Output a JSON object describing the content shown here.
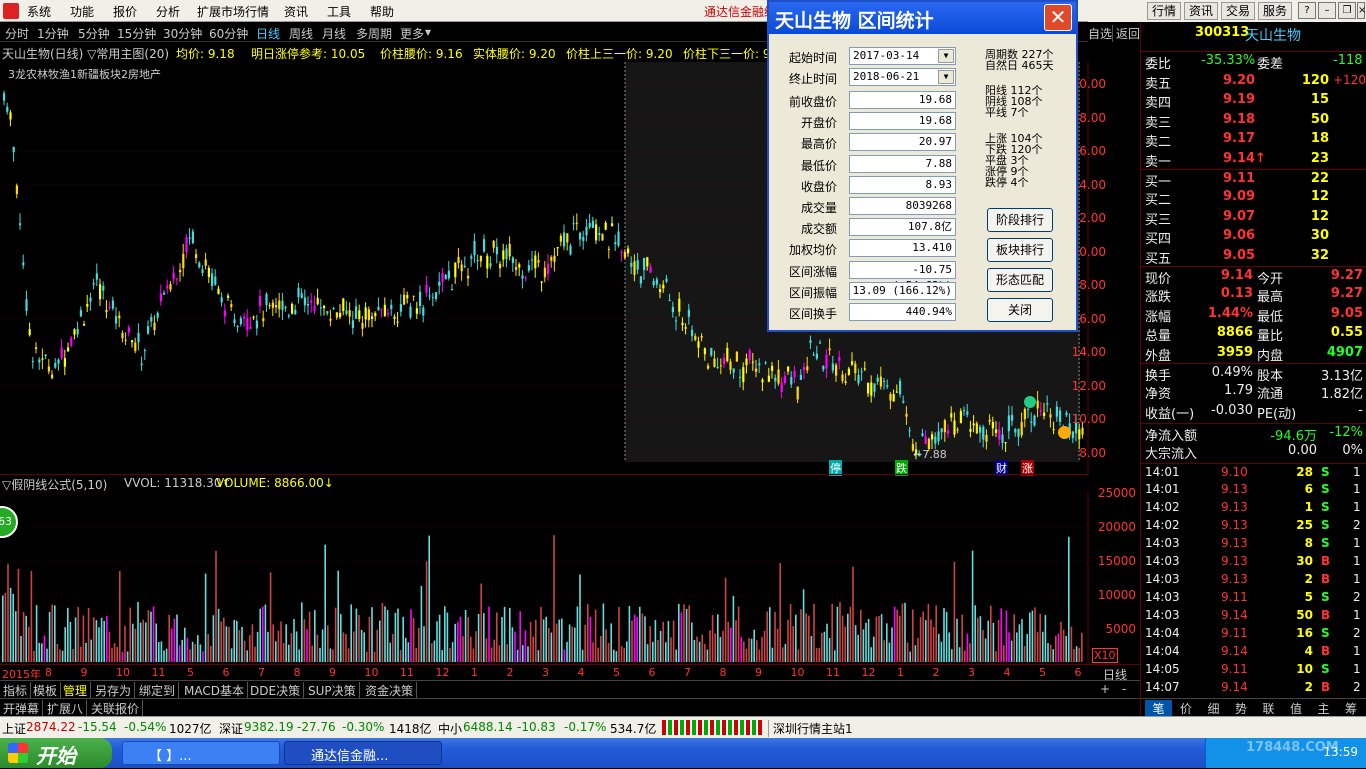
{
  "menu": {
    "items": [
      "系统",
      "功能",
      "报价",
      "分析",
      "扩展市场行情",
      "资讯",
      "工具",
      "帮助"
    ],
    "brand": "通达信金融终",
    "right_buttons": [
      "行情",
      "资讯",
      "交易",
      "服务"
    ]
  },
  "periods": {
    "items": [
      "分时",
      "1分钟",
      "5分钟",
      "15分钟",
      "30分钟",
      "60分钟",
      "日线",
      "周线",
      "月线",
      "多周期",
      "更多"
    ],
    "active": "日线",
    "nav_right": [
      "自选",
      "返回"
    ]
  },
  "info_line": {
    "title": "天山生物(日线) ▽常用主图(20)",
    "avg": "均价: 9.18",
    "limit_ref": "明日涨停参考: 10.05",
    "waist": "价柱腰价: 9.16",
    "body_waist": "实体腰价: 9.20",
    "upper1": "价柱上三一价: 9.20",
    "lower1": "价柱下三一价: 9"
  },
  "sector_line": "3龙农林牧渔1新疆板块2房地产",
  "price_axis": [
    "30.00",
    "28.00",
    "26.00",
    "24.00",
    "22.00",
    "20.00",
    "18.00",
    "16.00",
    "14.00",
    "12.00",
    "10.00",
    "8.00"
  ],
  "low_label": "7.88",
  "event_tags": [
    "停",
    "跌",
    "财",
    "涨"
  ],
  "sub_info": {
    "name": "▽假阴线公式(5,10)",
    "vvol": "VVOL: 11318.30↑",
    "volume": "VOLUME: 8866.00↓"
  },
  "vol_axis": [
    "25000",
    "20000",
    "15000",
    "10000",
    "5000"
  ],
  "vol_unit": "X10",
  "vol_badge": "63",
  "x_axis": {
    "labels": [
      "2015年",
      "8",
      "9",
      "10",
      "11",
      "5",
      "6",
      "7",
      "8",
      "9",
      "10",
      "11",
      "12",
      "1",
      "2",
      "3",
      "4",
      "5",
      "6",
      "7",
      "8",
      "9",
      "10",
      "11",
      "12",
      "1",
      "2",
      "3",
      "4",
      "5",
      "6"
    ],
    "right": "日线"
  },
  "tabs_row1": [
    "指标",
    "模板",
    "管理",
    "另存为",
    "绑定到",
    "MACD基本",
    "DDE决策",
    "SUP决策",
    "资金决策"
  ],
  "tabs_row1_selected": "管理",
  "tabs_row2": [
    "开弹幕",
    "扩展八",
    "关联报价"
  ],
  "dialog": {
    "title": "天山生物  区间统计",
    "start_label": "起始时间",
    "start": "2017-03-14",
    "end_label": "终止时间",
    "end": "2018-06-21",
    "fields": [
      {
        "label": "前收盘价",
        "value": "19.68"
      },
      {
        "label": "开盘价",
        "value": "19.68"
      },
      {
        "label": "最高价",
        "value": "20.97"
      },
      {
        "label": "最低价",
        "value": "7.88"
      },
      {
        "label": "收盘价",
        "value": "8.93"
      },
      {
        "label": "成交量",
        "value": "8039268"
      },
      {
        "label": "成交额",
        "value": "107.8亿"
      },
      {
        "label": "加权均价",
        "value": "13.410"
      },
      {
        "label": "区间涨幅",
        "value": "-10.75 (-54.62%)"
      },
      {
        "label": "区间振幅",
        "value": "13.09 (166.12%)"
      },
      {
        "label": "区间换手",
        "value": "440.94%"
      }
    ],
    "stats1": [
      "周期数  227个",
      "自然日  465天"
    ],
    "stats2": [
      "阳线  112个",
      "阴线  108个",
      "平线  7个"
    ],
    "stats3": [
      "上涨  104个",
      "下跌  120个",
      "平盘  3个",
      "涨停  9个",
      "跌停  4个"
    ],
    "buttons": [
      "阶段排行",
      "板块排行",
      "形态匹配",
      "关闭"
    ]
  },
  "quote": {
    "code": "300313",
    "name": "天山生物",
    "weibi_label": "委比",
    "weibi": "-35.33%",
    "weicha_label": "委差",
    "weicha": "-118",
    "sells": [
      {
        "label": "卖五",
        "price": "9.20",
        "vol": "120",
        "chg": "+120"
      },
      {
        "label": "卖四",
        "price": "9.19",
        "vol": "15",
        "chg": ""
      },
      {
        "label": "卖三",
        "price": "9.18",
        "vol": "50",
        "chg": ""
      },
      {
        "label": "卖二",
        "price": "9.17",
        "vol": "18",
        "chg": ""
      },
      {
        "label": "卖一",
        "price": "9.14↑",
        "vol": "23",
        "chg": ""
      }
    ],
    "buys": [
      {
        "label": "买一",
        "price": "9.11",
        "vol": "22"
      },
      {
        "label": "买二",
        "price": "9.09",
        "vol": "12"
      },
      {
        "label": "买三",
        "price": "9.07",
        "vol": "12"
      },
      {
        "label": "买四",
        "price": "9.06",
        "vol": "30"
      },
      {
        "label": "买五",
        "price": "9.05",
        "vol": "32"
      }
    ],
    "stats": [
      [
        "现价",
        "9.14",
        "今开",
        "9.27"
      ],
      [
        "涨跌",
        "0.13",
        "最高",
        "9.27"
      ],
      [
        "涨幅",
        "1.44%",
        "最低",
        "9.05"
      ],
      [
        "总量",
        "8866",
        "量比",
        "0.55"
      ],
      [
        "外盘",
        "3959",
        "内盘",
        "4907"
      ]
    ],
    "stats2": [
      [
        "换手",
        "0.49%",
        "股本",
        "3.13亿"
      ],
      [
        "净资",
        "1.79",
        "流通",
        "1.82亿"
      ],
      [
        "收益(一)",
        "-0.030",
        "PE(动)",
        "-"
      ]
    ],
    "flow": [
      [
        "净流入额",
        "-94.6万",
        "-12%"
      ],
      [
        "大宗流入",
        "0.00",
        "0%"
      ]
    ],
    "ticks": [
      [
        "14:01",
        "9.10",
        "28",
        "S",
        "1"
      ],
      [
        "14:01",
        "9.13",
        "6",
        "S",
        "1"
      ],
      [
        "14:02",
        "9.13",
        "1",
        "S",
        "1"
      ],
      [
        "14:02",
        "9.13",
        "25",
        "S",
        "2"
      ],
      [
        "14:03",
        "9.13",
        "8",
        "S",
        "1"
      ],
      [
        "14:03",
        "9.13",
        "30",
        "B",
        "1"
      ],
      [
        "14:03",
        "9.13",
        "2",
        "B",
        "1"
      ],
      [
        "14:03",
        "9.11",
        "5",
        "S",
        "2"
      ],
      [
        "14:03",
        "9.14",
        "50",
        "B",
        "1"
      ],
      [
        "14:04",
        "9.11",
        "16",
        "S",
        "2"
      ],
      [
        "14:04",
        "9.14",
        "4",
        "B",
        "1"
      ],
      [
        "14:05",
        "9.11",
        "10",
        "S",
        "1"
      ],
      [
        "14:07",
        "9.14",
        "2",
        "B",
        "2"
      ]
    ],
    "bottom_tabs": [
      "笔",
      "价",
      "细",
      "势",
      "联",
      "值",
      "主",
      "筹"
    ]
  },
  "status": {
    "sh": "上证",
    "sh_val": "2874.22",
    "sh_chg": "-15.54",
    "sh_pct": "-0.54%",
    "sh_amt": "1027亿",
    "sz": "深证",
    "sz_val": "9382.19",
    "sz_chg": "-27.76",
    "sz_pct": "-0.30%",
    "sz_amt": "1418亿",
    "zx": "中小",
    "zx_val": "6488.14",
    "zx_chg": "-10.83",
    "zx_pct": "-0.17%",
    "zx_amt": "534.7亿",
    "server": "深圳行情主站1"
  },
  "taskbar": {
    "start": "开始",
    "items": [
      "【         】...",
      "通达信金融..."
    ],
    "time": "13:59",
    "watermark": "178448.COM"
  }
}
